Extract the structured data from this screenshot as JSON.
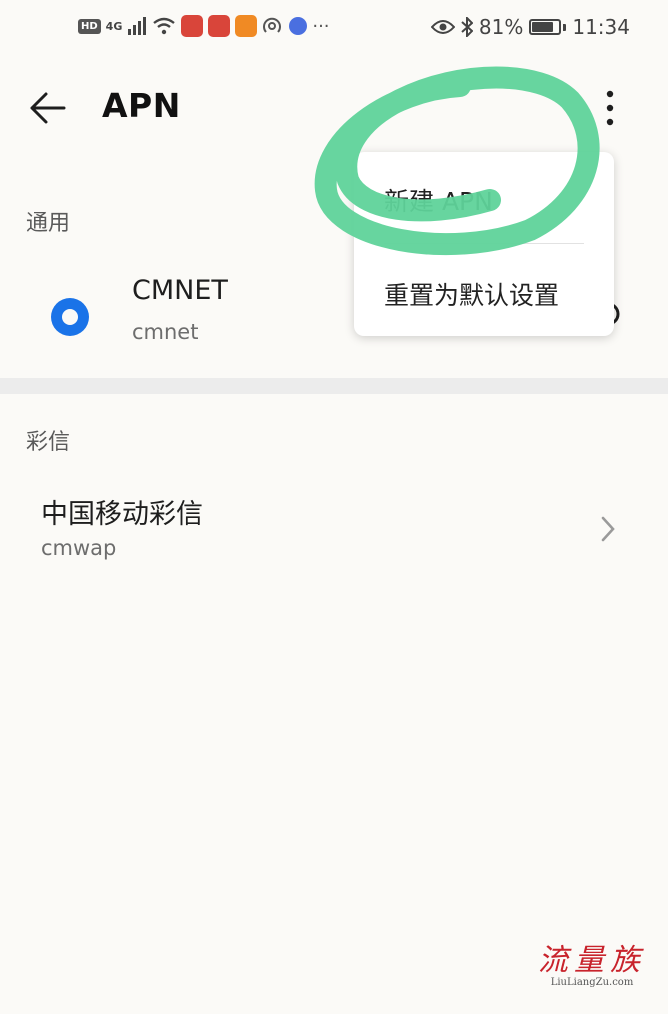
{
  "status_bar": {
    "hd": "HD",
    "network": "4G",
    "battery_text": "81%",
    "battery_level": 0.81,
    "time": "11:34",
    "more": "···"
  },
  "toolbar": {
    "title": "APN"
  },
  "general_section": {
    "header": "通用",
    "apn": {
      "name": "CMNET",
      "value": "cmnet",
      "selected": true
    }
  },
  "mms_section": {
    "header": "彩信",
    "apn": {
      "name": "中国移动彩信",
      "value": "cmwap"
    }
  },
  "popup_menu": {
    "items": [
      "新建 APN",
      "重置为默认设置"
    ]
  },
  "watermark": {
    "main": "流量族",
    "sub": "LiuLiangZu.com"
  },
  "colors": {
    "accent": "#1a73e8",
    "annotation": "#5fd39a",
    "watermark": "#c8232c"
  }
}
